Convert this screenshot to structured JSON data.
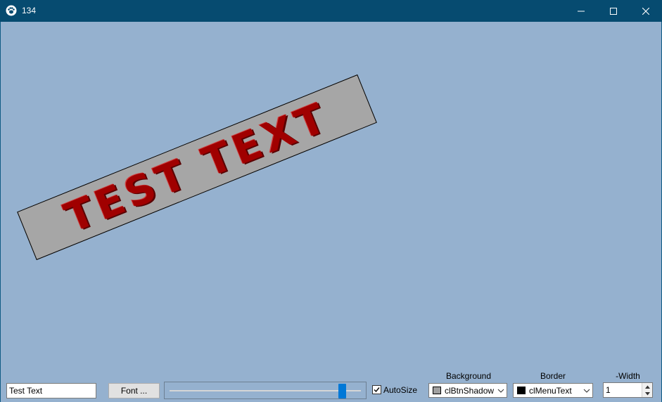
{
  "window": {
    "title": "134",
    "icon": "paw-icon",
    "controls": [
      "minimize-icon",
      "maximize-icon",
      "close-icon"
    ],
    "titlebar_color": "#064b70",
    "client_color": "#95b1cf"
  },
  "canvas": {
    "text": "TEST TEXT",
    "text_color": "#a00000",
    "background_color": "#a6a6a6",
    "rotation_degrees": 22
  },
  "toolbar": {
    "text_input_value": "Test Text",
    "font_button_label": "Font ...",
    "slider_value_fraction": 0.92,
    "autosize_label": "AutoSize",
    "autosize_checked": true,
    "background": {
      "label": "Background",
      "value": "clBtnShadow",
      "swatch_color": "#a0a0a0"
    },
    "border": {
      "label": "Border",
      "value": "clMenuText",
      "swatch_color": "#000000"
    },
    "width": {
      "label": "-Width",
      "value": "1"
    }
  }
}
